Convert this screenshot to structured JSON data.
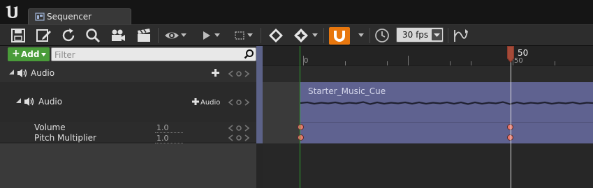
{
  "colors": {
    "accent_orange": "#e8770e",
    "add_green": "#4a9c3a",
    "section_purple": "#5f6290",
    "start_marker_green": "#2fa32f",
    "key_red": "#e8796e"
  },
  "window": {
    "tab_label": "Sequencer",
    "logo_icon": "unreal-engine-logo"
  },
  "toolbar": {
    "icons": [
      "save-icon",
      "save-as-icon",
      "refresh-icon",
      "search-icon",
      "camera-icon",
      "clapperboard-icon",
      "eye-icon",
      "play-icon",
      "selection-icon",
      "key-diamond-icon",
      "key-all-icon",
      "magnet-snap-icon",
      "clock-icon",
      "curve-editor-icon"
    ],
    "fps_value": "30 fps"
  },
  "outliner": {
    "add_label": "Add",
    "filter_placeholder": "Filter",
    "root_track_label": "Audio",
    "audio_track_label": "Audio",
    "add_audio_label": "Audio",
    "properties": [
      {
        "label": "Volume",
        "value": "1.0"
      },
      {
        "label": "Pitch Multiplier",
        "value": "1.0"
      }
    ]
  },
  "timeline": {
    "start_frame": "0",
    "current_frame": "50",
    "tick_label_start": "0",
    "tick_label_current": "50",
    "section_label": "Starter_Music_Cue"
  }
}
